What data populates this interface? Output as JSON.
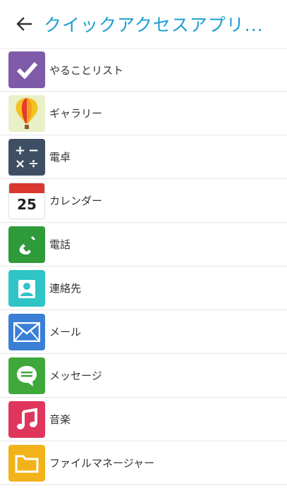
{
  "header": {
    "title": "クイックアクセスアプリ..."
  },
  "items": [
    {
      "label": "やることリスト",
      "icon": "todo-checkmark-icon",
      "color": "#7e5aa8"
    },
    {
      "label": "ギャラリー",
      "icon": "gallery-balloon-icon",
      "color": "#e8f0c8"
    },
    {
      "label": "電卓",
      "icon": "calculator-icon",
      "color": "#3e4f63"
    },
    {
      "label": "カレンダー",
      "icon": "calendar-icon",
      "color": "#ffffff",
      "day": "25"
    },
    {
      "label": "電話",
      "icon": "phone-icon",
      "color": "#2e9a3a"
    },
    {
      "label": "連絡先",
      "icon": "contacts-icon",
      "color": "#2fc4c6"
    },
    {
      "label": "メール",
      "icon": "mail-icon",
      "color": "#3a7fd4"
    },
    {
      "label": "メッセージ",
      "icon": "message-icon",
      "color": "#3fa83a"
    },
    {
      "label": "音楽",
      "icon": "music-icon",
      "color": "#e0355c"
    },
    {
      "label": "ファイルマネージャー",
      "icon": "folder-icon",
      "color": "#f2b31a"
    }
  ]
}
